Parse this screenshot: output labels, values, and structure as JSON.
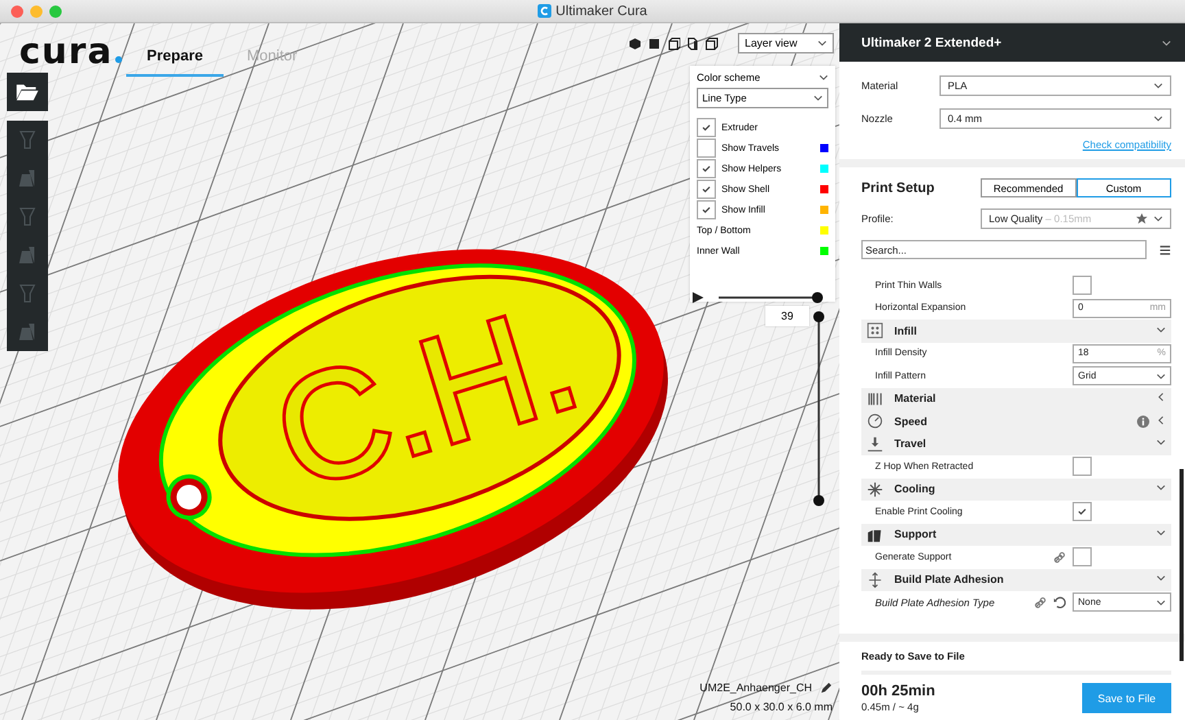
{
  "window": {
    "title": "Ultimaker Cura"
  },
  "logo": "cura",
  "tabs": [
    {
      "label": "Prepare",
      "selected": true
    },
    {
      "label": "Monitor",
      "selected": false
    }
  ],
  "view_mode": {
    "value": "Layer view"
  },
  "layer_panel": {
    "title": "Color scheme",
    "scheme": "Line Type",
    "legend": [
      {
        "kind": "checkbox",
        "label": "Extruder",
        "checked": true
      },
      {
        "kind": "checkbox",
        "label": "Show Travels",
        "checked": false,
        "color": "#0000ff"
      },
      {
        "kind": "checkbox",
        "label": "Show Helpers",
        "checked": true,
        "color": "#00ffff"
      },
      {
        "kind": "checkbox",
        "label": "Show Shell",
        "checked": true,
        "color": "#ff0000"
      },
      {
        "kind": "checkbox",
        "label": "Show Infill",
        "checked": true,
        "color": "#ffb400"
      },
      {
        "kind": "plain",
        "label": "Top / Bottom",
        "color": "#ffff00"
      },
      {
        "kind": "plain",
        "label": "Inner Wall",
        "color": "#00ff00"
      }
    ]
  },
  "line_slider": {
    "level": 1
  },
  "layer_slider": {
    "value": "39",
    "level": 1
  },
  "model": {
    "text": "C.H.",
    "name": "UM2E_Anhaenger_CH",
    "dimensions": "50.0 x 30.0 x 6.0 mm"
  },
  "printer": {
    "name": "Ultimaker 2 Extended+",
    "material_label": "Material",
    "material": "PLA",
    "nozzle_label": "Nozzle",
    "nozzle": "0.4 mm",
    "link": "Check compatibility"
  },
  "print_setup": {
    "title": "Print Setup",
    "modes": [
      {
        "label": "Recommended",
        "selected": false
      },
      {
        "label": "Custom",
        "selected": true
      }
    ],
    "profile_label": "Profile:",
    "profile": "Low Quality",
    "profile_detail": "– 0.15mm",
    "search_placeholder": "Search..."
  },
  "settings": [
    {
      "kind": "checkbox",
      "label": "Print Thin Walls",
      "checked": false
    },
    {
      "kind": "number",
      "label": "Horizontal Expansion",
      "value": "0",
      "unit": "mm"
    },
    {
      "kind": "category",
      "label": "Infill",
      "expanded": true
    },
    {
      "kind": "number",
      "label": "Infill Density",
      "value": "18",
      "unit": "%"
    },
    {
      "kind": "dropdown",
      "label": "Infill Pattern",
      "value": "Grid"
    },
    {
      "kind": "category",
      "label": "Material",
      "expanded": false
    },
    {
      "kind": "category",
      "label": "Speed",
      "expanded": false,
      "info": true
    },
    {
      "kind": "category",
      "label": "Travel",
      "expanded": true
    },
    {
      "kind": "checkbox",
      "label": "Z Hop When Retracted",
      "checked": false
    },
    {
      "kind": "category",
      "label": "Cooling",
      "expanded": true
    },
    {
      "kind": "checkbox",
      "label": "Enable Print Cooling",
      "checked": true
    },
    {
      "kind": "category",
      "label": "Support",
      "expanded": true
    },
    {
      "kind": "checkbox",
      "label": "Generate Support",
      "checked": false,
      "linked": true
    },
    {
      "kind": "category",
      "label": "Build Plate Adhesion",
      "expanded": true
    },
    {
      "kind": "dropdown",
      "label": "Build Plate Adhesion Type",
      "value": "None",
      "linked": true,
      "modified": true
    }
  ],
  "footer": {
    "status": "Ready to Save to File",
    "time": "00h 25min",
    "material_use": "0.45m / ~ 4g",
    "button": "Save to File"
  }
}
